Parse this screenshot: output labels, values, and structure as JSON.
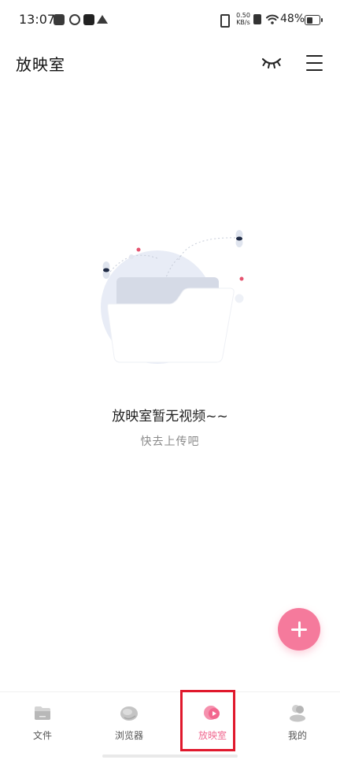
{
  "status_bar": {
    "time": "13:07",
    "net_speed_value": "0.50",
    "net_speed_unit": "KB/s",
    "battery_percent": "48%",
    "battery_level": 0.48,
    "icons": [
      "inbox-icon",
      "ring-icon",
      "tiktok-icon",
      "crown-icon",
      "vibrate-icon",
      "no-sim-icon",
      "wifi-icon",
      "battery-icon"
    ]
  },
  "header": {
    "title": "放映室",
    "actions": [
      "eye-closed-icon",
      "menu-icon"
    ]
  },
  "empty_state": {
    "title": "放映室暂无视频~~",
    "subtitle": "快去上传吧"
  },
  "fab": {
    "icon": "plus-icon",
    "color": "#f57a9c"
  },
  "bottom_nav": {
    "active_index": 2,
    "accent_color": "#f06a91",
    "items": [
      {
        "label": "文件",
        "icon": "file-icon"
      },
      {
        "label": "浏览器",
        "icon": "browser-icon"
      },
      {
        "label": "放映室",
        "icon": "theater-icon"
      },
      {
        "label": "我的",
        "icon": "profile-icon"
      }
    ]
  },
  "highlight_color": "#e0182c"
}
